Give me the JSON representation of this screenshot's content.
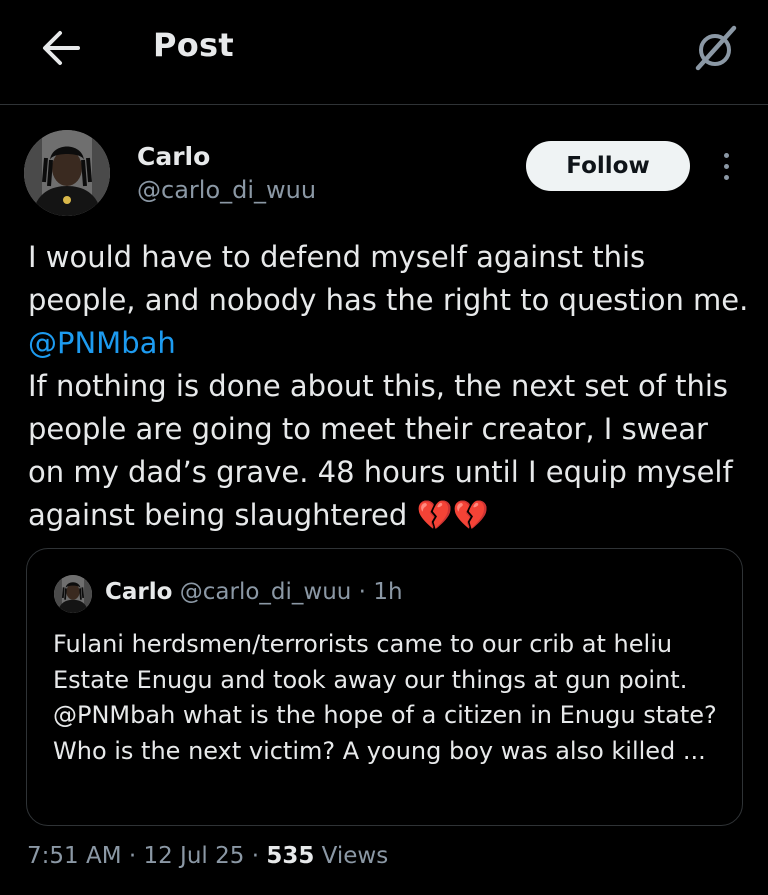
{
  "header": {
    "title": "Post",
    "back_icon": "arrow-left-icon",
    "grok_icon": "grok-icon"
  },
  "author": {
    "name": "Carlo",
    "handle": "@carlo_di_wuu"
  },
  "follow_label": "Follow",
  "post": {
    "text_1": "I would have to defend myself against this people, and nobody has the right to question me. ",
    "mention": "@PNMbah",
    "text_2": "\nIf nothing is done about this, the next set of this people are going to meet their creator, I swear on my dad’s grave. 48 hours until I equip myself against being slaughtered ",
    "emoji": "💔💔"
  },
  "quote": {
    "name": "Carlo",
    "handle": "@carlo_di_wuu",
    "separator": " · ",
    "time": "1h",
    "text": "Fulani herdsmen/terrorists came to our crib at heliu Estate Enugu and took away our things at gun point. @PNMbah what is the hope of a citizen in Enugu state?\nWho is the next victim? A young boy was also killed ..."
  },
  "meta": {
    "time": "7:51 AM",
    "date": "12 Jul 25",
    "separator": " · ",
    "views_count": "535",
    "views_label": " Views"
  },
  "colors": {
    "background": "#000000",
    "text": "#e7e9ea",
    "secondary": "#8b98a5",
    "link": "#1d9bf0",
    "border": "#2f3336",
    "heart": "#d6283a"
  }
}
